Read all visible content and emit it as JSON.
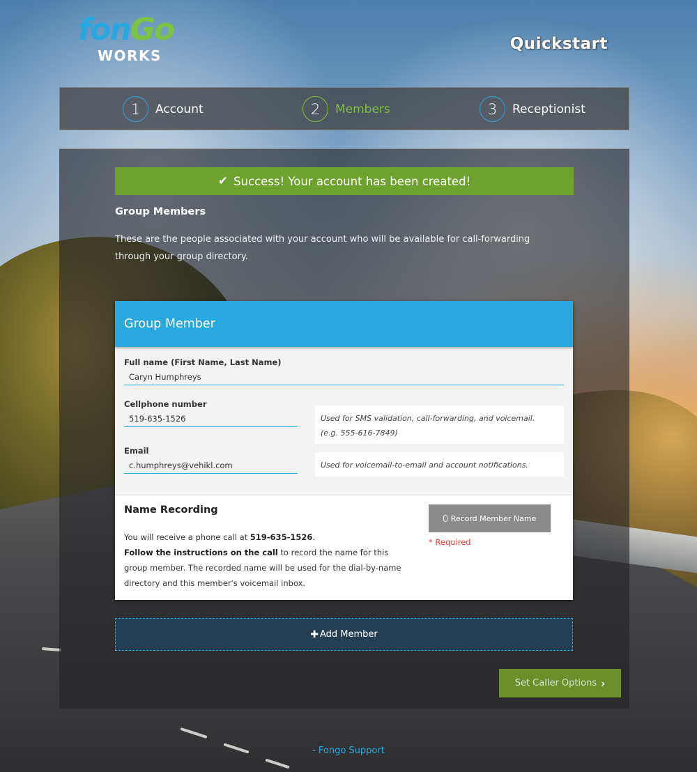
{
  "header": {
    "logo_fongo_part1": "fon",
    "logo_fongo_part2": "Go",
    "logo_works": "WORKS",
    "title": "Quickstart"
  },
  "steps": [
    {
      "number": "1",
      "label": "Account",
      "state": "done"
    },
    {
      "number": "2",
      "label": "Members",
      "state": "active"
    },
    {
      "number": "3",
      "label": "Receptionist",
      "state": "pending"
    }
  ],
  "alert": {
    "icon": "check-icon",
    "text": "Success! Your account has been created!"
  },
  "section": {
    "heading": "Group Members",
    "description": "These are the people associated with your account who will be available for call-forwarding through your group directory."
  },
  "member_card": {
    "title": "Group Member",
    "full_name": {
      "label": "Full name (First Name, Last Name)",
      "value": "Caryn Humphreys"
    },
    "cellphone": {
      "label": "Cellphone number",
      "value": "519-635-1526",
      "hint_line1": "Used for SMS validation, call-forwarding, and voicemail.",
      "hint_line2": "(e.g. 555-616-7849)"
    },
    "email": {
      "label": "Email",
      "value": "c.humphreys@vehikl.com",
      "hint": "Used for voicemail-to-email and account notifications."
    },
    "recording": {
      "title": "Name Recording",
      "text_prefix": "You will receive a phone call at ",
      "phone": "519-635-1526",
      "text_period": ".",
      "instructions_bold": "Follow the instructions on the call",
      "instructions_rest": " to record the name for this group member. The recorded name will be used for the dial-by-name directory and this member's voicemail inbox.",
      "button_label": "Record Member Name",
      "button_icon": "microphone-icon",
      "required": "* Required"
    }
  },
  "add_member": {
    "icon": "plus-icon",
    "label": "Add Member"
  },
  "next_button": {
    "label": "Set Caller Options",
    "icon": "chevron-right-icon"
  },
  "footer": {
    "separator": "-",
    "link": "Fongo Support"
  },
  "colors": {
    "accent_blue": "#29a8e0",
    "accent_green": "#7dc242",
    "success_green": "#6ea22f",
    "button_green": "#6a8f2c",
    "required_red": "#e3342f"
  }
}
